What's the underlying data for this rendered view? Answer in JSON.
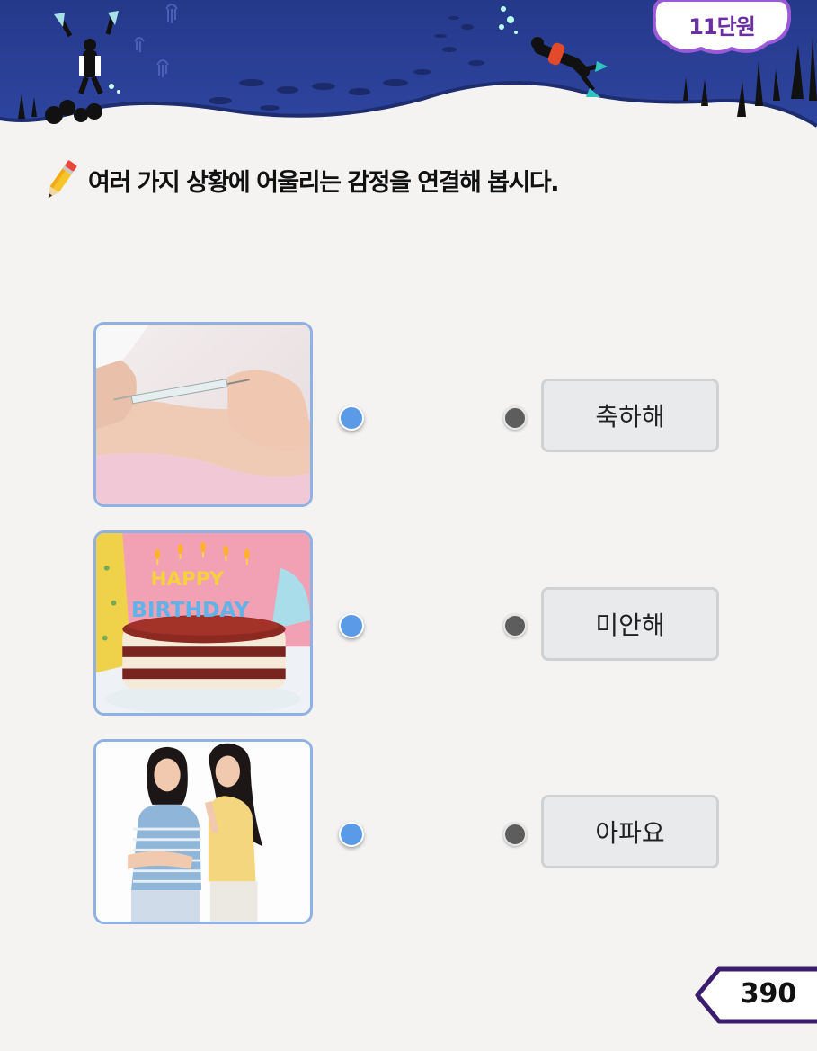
{
  "header": {
    "unit_label": "11단원"
  },
  "instruction": {
    "text": "여러 가지 상황에 어울리는 감정을 연결해 봅시다.",
    "icon": "pencil-icon"
  },
  "photos": [
    {
      "subject": "injection",
      "icon": "injection-photo"
    },
    {
      "subject": "birthday-cake",
      "icon": "birthday-cake-photo",
      "cake_text_top": "HAPPY",
      "cake_text_bottom": "BIRTHDAY"
    },
    {
      "subject": "two-girls-apologizing",
      "icon": "apology-photo"
    }
  ],
  "emotions": [
    {
      "label": "축하해"
    },
    {
      "label": "미안해"
    },
    {
      "label": "아파요"
    }
  ],
  "page": {
    "number": "390"
  },
  "colors": {
    "header_navy": "#2b3f8f",
    "badge_purple": "#6a2fa0",
    "photo_border": "#8fb2e2",
    "dot_blue": "#5a9ae6",
    "dot_gray": "#5d5d5d",
    "page_tab_border": "#3b1d6e"
  }
}
